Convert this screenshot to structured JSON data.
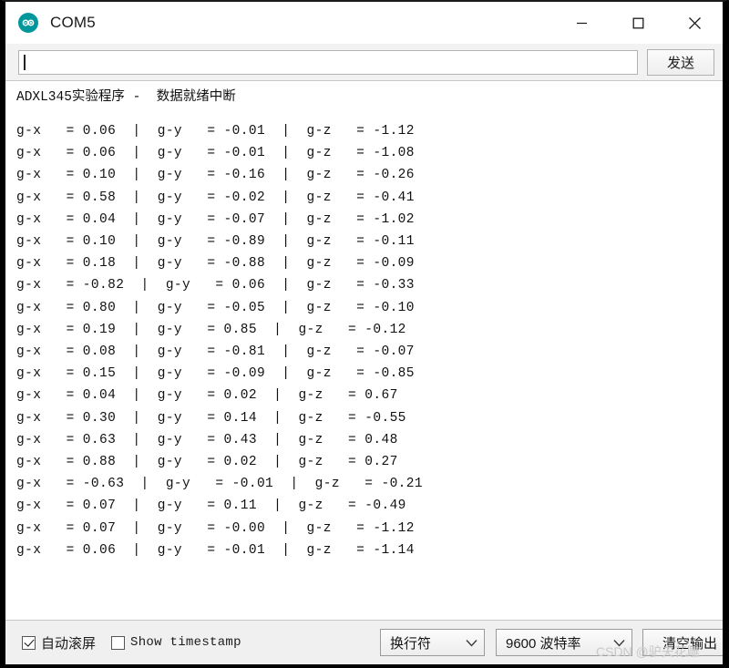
{
  "window": {
    "title": "COM5",
    "app_icon": "arduino-infinity-icon",
    "controls": {
      "minimize": "minimize-icon",
      "maximize": "maximize-icon",
      "close": "close-icon"
    }
  },
  "send_bar": {
    "input_value": "",
    "input_placeholder": "",
    "send_label": "发送"
  },
  "console": {
    "banner": "ADXL345实验程序 -  数据就绪中断",
    "lines": [
      "g-x   = 0.06  |  g-y   = -0.01  |  g-z   = -1.12",
      "g-x   = 0.06  |  g-y   = -0.01  |  g-z   = -1.08",
      "g-x   = 0.10  |  g-y   = -0.16  |  g-z   = -0.26",
      "g-x   = 0.58  |  g-y   = -0.02  |  g-z   = -0.41",
      "g-x   = 0.04  |  g-y   = -0.07  |  g-z   = -1.02",
      "g-x   = 0.10  |  g-y   = -0.89  |  g-z   = -0.11",
      "g-x   = 0.18  |  g-y   = -0.88  |  g-z   = -0.09",
      "g-x   = -0.82  |  g-y   = 0.06  |  g-z   = -0.33",
      "g-x   = 0.80  |  g-y   = -0.05  |  g-z   = -0.10",
      "g-x   = 0.19  |  g-y   = 0.85  |  g-z   = -0.12",
      "g-x   = 0.08  |  g-y   = -0.81  |  g-z   = -0.07",
      "g-x   = 0.15  |  g-y   = -0.09  |  g-z   = -0.85",
      "g-x   = 0.04  |  g-y   = 0.02  |  g-z   = 0.67",
      "g-x   = 0.30  |  g-y   = 0.14  |  g-z   = -0.55",
      "g-x   = 0.63  |  g-y   = 0.43  |  g-z   = 0.48",
      "g-x   = 0.88  |  g-y   = 0.02  |  g-z   = 0.27",
      "g-x   = -0.63  |  g-y   = -0.01  |  g-z   = -0.21",
      "g-x   = 0.07  |  g-y   = 0.11  |  g-z   = -0.49",
      "g-x   = 0.07  |  g-y   = -0.00  |  g-z   = -1.12",
      "g-x   = 0.06  |  g-y   = -0.01  |  g-z   = -1.14"
    ]
  },
  "status_bar": {
    "autoscroll_label": "自动滚屏",
    "autoscroll_checked": true,
    "timestamp_label": "Show timestamp",
    "timestamp_checked": false,
    "line_ending_value": "换行符",
    "baud_value": "9600 波特率",
    "clear_label": "清空输出"
  },
  "watermark": "CSDN @驴夫花雕"
}
